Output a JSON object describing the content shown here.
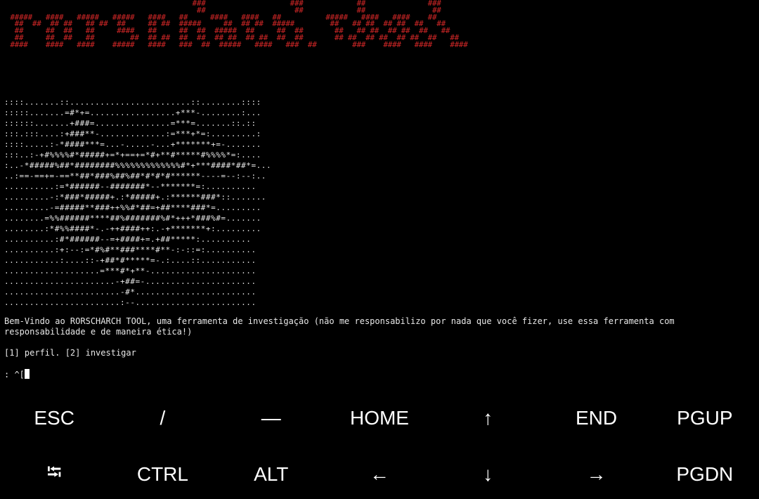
{
  "banner": {
    "text": "                                          ###                   ###            ##              ###\n                                           ##                    ##            ##               ##\n #####   ####   #####   #####   ####   ##     ####   ####   ##          #####   ####   ####    ##\n  ##  ##  ## ##   ## ##  ##     ## ##  #####     ##  ## ##  #####        ##   ## ##  ## ##  ##   ##\n  ##     ##  ##   ##     ####   ##     ##  ##  #####  ##     ##  ##       ##   ## ##  ## ##  ##   ##\n  ##     ##  ##   ##        ##  ## ##  ##  ##  ## ##  ## ##  ##  ##       ## ##  ## ##  ## ##  ##   ##\n ####    ####   ####    #####   ####   ###  ##  #####   ####   ###  ##        ###    ####   ####    ####",
    "color": "#d42727"
  },
  "ascii_art": "::::.......::........................::........::::\n:::::.......=#*+=.................+***-........:...\n::::::.......+###=...............=***=.......::.::\n:::.:::....:+###**-.............:=***+*=:.........:\n::::.....:-*####***=...-.....-...+*******+=-.......\n:::..:-+#%%%%#*#####+=*+==+=*#+**#*****#%%%%*=:....\n:..-*#####%##*########%%%%%%%%%%%%%#*+***####*##*=...\n..:==-==+=-==**##*###%##%##*#*#*#******----=--:--:..\n..........:=*######--#######*--*******=:..........\n.........-:*###*#####+.:*#####+.:******###*::.......\n.........-=#####**###++%%#*##=+##****###*=.........\n........=%%######****##%#######%#*+++*###%#=.......\n........:*#%%####*-.-++####++:.-+*******+:.........\n..........:#*######--=+####+=.+##*****:..........\n..........:+:--:=*#%#**###****#**-:-::=:..........\n...........:....::-+##*#*****=-.:....::...........\n...................=***#*+**-.....................\n......................-+##=-......................\n.......................-#*........................\n.......................:--........................",
  "welcome_text": "Bem-Vindo ao RORSCHARCH TOOL, uma ferramenta de investigação (não me responsabilizo por nada que você fizer, use essa ferramenta com responsabilidade e de maneira ética!)",
  "menu_text": "[1] perfil. [2] investigar",
  "prompt": ": ^[",
  "extra_keys": {
    "row1": [
      "ESC",
      "/",
      "—",
      "HOME",
      "↑",
      "END",
      "PGUP"
    ],
    "row2": [
      "⭾",
      "CTRL",
      "ALT",
      "←",
      "↓",
      "→",
      "PGDN"
    ]
  }
}
